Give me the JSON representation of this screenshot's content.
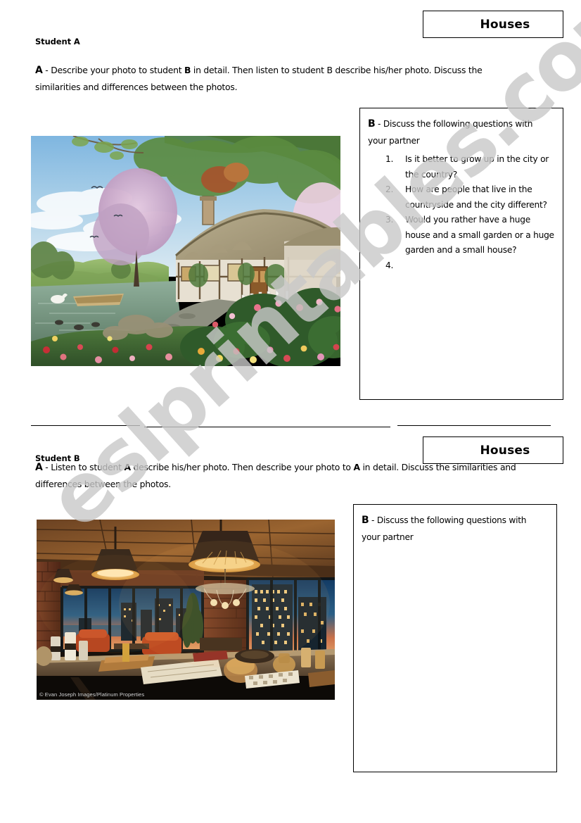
{
  "worksheet": {
    "topic": "Houses",
    "sections": [
      {
        "student_label": "Student A",
        "title": "Houses",
        "task_letter": "A",
        "task_text_1": " - Describe your photo to student ",
        "task_bold_2": "B",
        "task_text_3": " in detail. Then listen to student B describe his/her photo. Discuss the similarities and differences between the photos.",
        "photo": {
          "name": "countryside-thatched-cottage",
          "alt": "Thatched country cottage beside a pond with flower garden, rowing boat, ducks and rolling green hills",
          "caption": ""
        },
        "question_box": {
          "intro_letter": "B",
          "intro_text": " - Discuss the following questions with your partner",
          "questions": [
            {
              "number": "1.",
              "text": "Is it better to grow up in the city or the country?"
            },
            {
              "number": "2.",
              "text": "How are people that live in the countryside and the city different?"
            },
            {
              "number": "3.",
              "text": "Would you rather have a huge house and a small garden or a huge garden and a small house?"
            },
            {
              "number": "4.",
              "text": ""
            }
          ]
        }
      },
      {
        "student_label": "Student B",
        "title": "Houses",
        "task_letter": "A",
        "task_text_1": " - Listen to student ",
        "task_bold_2": "A",
        "task_text_3": " describe his/her photo. Then describe your photo to ",
        "task_bold_4": "A",
        "task_text_5": " in detail. Discuss the similarities and differences between the photos.",
        "photo": {
          "name": "urban-loft-penthouse-kitchen",
          "alt": "Industrial loft penthouse kitchen with pendant lamps, exposed brick and city skyline at dusk through floor-to-ceiling windows",
          "caption": "© Evan Joseph Images/Platinum Properties"
        },
        "question_box": {
          "intro_letter": "B",
          "intro_text": " - Discuss the following questions with your partner",
          "questions": []
        }
      }
    ],
    "watermark": "eslprintables.com"
  },
  "colors": {
    "ink": "#000000",
    "paper": "#ffffff",
    "watermark": "#c9c9c9"
  }
}
